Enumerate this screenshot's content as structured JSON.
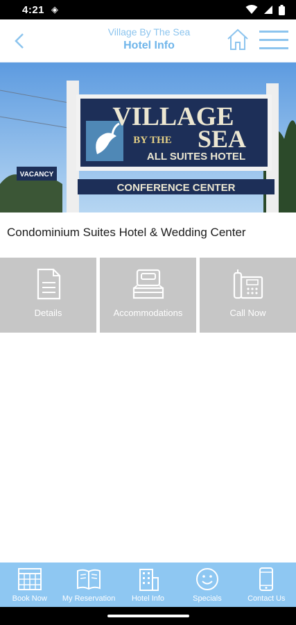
{
  "status_bar": {
    "time": "4:21"
  },
  "header": {
    "subtitle": "Village By The Sea",
    "title": "Hotel Info"
  },
  "hero": {
    "sign_line1": "VILLAGE",
    "sign_line2a": "BY THE",
    "sign_line2b": "SEA",
    "sign_line3": "ALL SUITES HOTEL",
    "sign_banner": "CONFERENCE CENTER",
    "vacancy": "VACANCY"
  },
  "tagline": "Condominium Suites Hotel & Wedding Center",
  "tiles": [
    {
      "label": "Details",
      "icon": "document-icon"
    },
    {
      "label": "Accommodations",
      "icon": "bed-icon"
    },
    {
      "label": "Call Now",
      "icon": "phone-icon"
    }
  ],
  "bottom_nav": [
    {
      "label": "Book Now",
      "icon": "calendar-icon"
    },
    {
      "label": "My Reservation",
      "icon": "book-icon"
    },
    {
      "label": "Hotel Info",
      "icon": "building-icon"
    },
    {
      "label": "Specials",
      "icon": "smiley-icon"
    },
    {
      "label": "Contact Us",
      "icon": "mobile-icon"
    }
  ],
  "colors": {
    "accent": "#6fb5ea",
    "nav_bg": "#8ec7f2",
    "tile_bg": "#c6c6c6",
    "sign_navy": "#1d2f58"
  }
}
